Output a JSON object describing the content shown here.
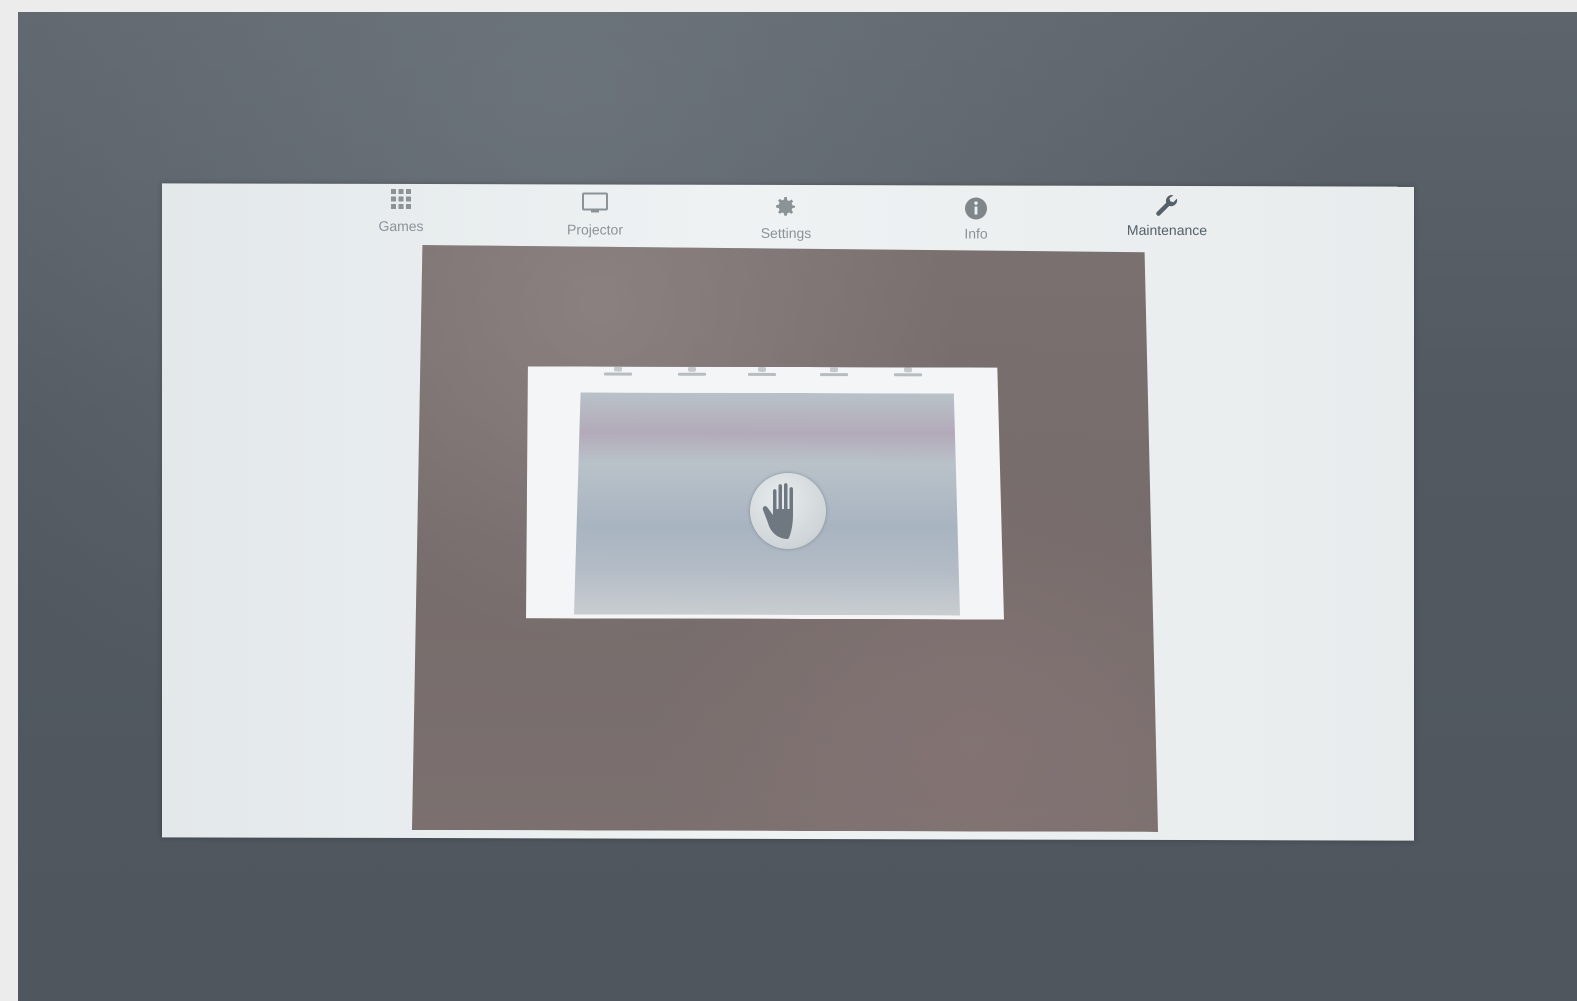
{
  "tabs": [
    {
      "label": "Games",
      "icon": "grid-icon",
      "active": false
    },
    {
      "label": "Projector",
      "icon": "monitor-icon",
      "active": false
    },
    {
      "label": "Settings",
      "icon": "gear-icon",
      "active": false
    },
    {
      "label": "Info",
      "icon": "info-icon",
      "active": false
    },
    {
      "label": "Maintenance",
      "icon": "wrench-icon",
      "active": true
    }
  ],
  "colors": {
    "tab_text": "#8c9396",
    "tab_active": "#55606a",
    "screen_bg": "#eef2f3",
    "feed_bg": "#766c6b"
  }
}
